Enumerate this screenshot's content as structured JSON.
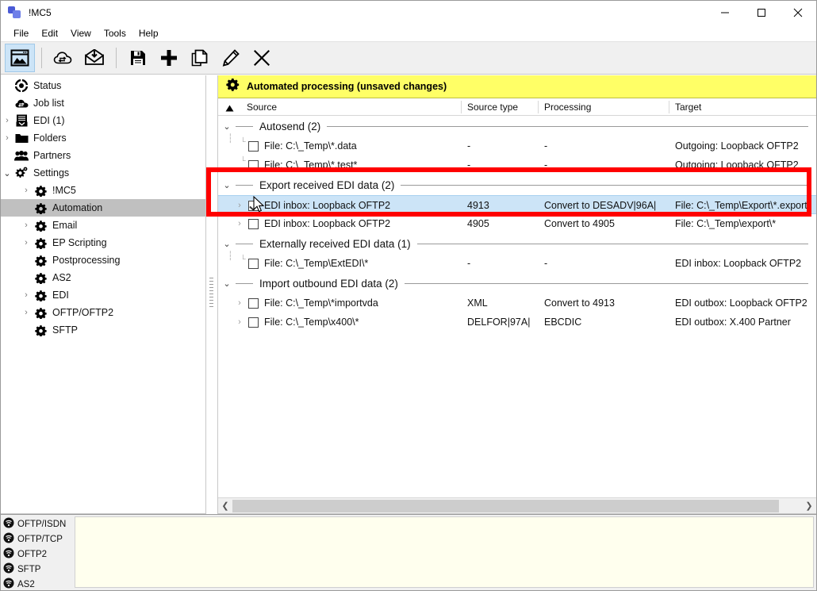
{
  "window": {
    "title": "!MC5",
    "app_icon": "app-logo-icon",
    "minimize": "minimize-icon",
    "maximize": "maximize-icon",
    "close": "close-icon"
  },
  "menu": {
    "items": [
      "File",
      "Edit",
      "View",
      "Tools",
      "Help"
    ]
  },
  "toolbar": {
    "buttons": [
      {
        "name": "overview-window-icon",
        "active": true
      },
      {
        "name": "cloud-transfer-icon",
        "active": false
      },
      {
        "name": "receive-mail-icon",
        "active": false
      },
      {
        "name": "save-icon",
        "active": false
      },
      {
        "name": "add-plus-icon",
        "active": false
      },
      {
        "name": "copy-page-icon",
        "active": false
      },
      {
        "name": "edit-pencil-icon",
        "active": false
      },
      {
        "name": "delete-x-icon",
        "active": false
      }
    ]
  },
  "sidebar": {
    "items": [
      {
        "label": "Status",
        "icon": "status-icon",
        "indent": 0,
        "chevron": "none",
        "selected": false
      },
      {
        "label": "Job list",
        "icon": "joblist-icon",
        "indent": 0,
        "chevron": "none",
        "selected": false
      },
      {
        "label": "EDI (1)",
        "icon": "edi-icon",
        "indent": 0,
        "chevron": "right",
        "selected": false
      },
      {
        "label": "Folders",
        "icon": "folder-icon",
        "indent": 0,
        "chevron": "right",
        "selected": false
      },
      {
        "label": "Partners",
        "icon": "partners-icon",
        "indent": 0,
        "chevron": "none",
        "selected": false
      },
      {
        "label": "Settings",
        "icon": "settings-gear-icon",
        "indent": 0,
        "chevron": "down",
        "selected": false
      },
      {
        "label": "!MC5",
        "icon": "gear-icon",
        "indent": 1,
        "chevron": "right",
        "selected": false
      },
      {
        "label": "Automation",
        "icon": "gear-icon",
        "indent": 1,
        "chevron": "none",
        "selected": true
      },
      {
        "label": "Email",
        "icon": "gear-icon",
        "indent": 1,
        "chevron": "right",
        "selected": false
      },
      {
        "label": "EP Scripting",
        "icon": "gear-icon",
        "indent": 1,
        "chevron": "right",
        "selected": false
      },
      {
        "label": "Postprocessing",
        "icon": "gear-icon",
        "indent": 1,
        "chevron": "none",
        "selected": false
      },
      {
        "label": "AS2",
        "icon": "gear-icon",
        "indent": 1,
        "chevron": "none",
        "selected": false
      },
      {
        "label": "EDI",
        "icon": "gear-icon",
        "indent": 1,
        "chevron": "right",
        "selected": false
      },
      {
        "label": "OFTP/OFTP2",
        "icon": "gear-icon",
        "indent": 1,
        "chevron": "right",
        "selected": false
      },
      {
        "label": "SFTP",
        "icon": "gear-icon",
        "indent": 1,
        "chevron": "none",
        "selected": false
      }
    ]
  },
  "main": {
    "header_title": "Automated processing (unsaved changes)",
    "header_icon": "gear-icon",
    "columns": [
      "Source",
      "Source type",
      "Processing",
      "Target"
    ],
    "sort_indicator": "sort-ascending-icon",
    "groups": [
      {
        "title": "Autosend (2)",
        "expanded": true,
        "rows": [
          {
            "source": "File: C:\\_Temp\\*.data",
            "source_type": "-",
            "processing": "-",
            "target": "Outgoing: Loopback OFTP2",
            "checked": false,
            "expandable": false,
            "selected": false
          },
          {
            "source": "File: C:\\_Temp\\*.test*",
            "source_type": "-",
            "processing": "-",
            "target": "Outgoing: Loopback OFTP2",
            "checked": false,
            "expandable": false,
            "selected": false
          }
        ]
      },
      {
        "title": "Export received EDI data (2)",
        "expanded": true,
        "rows": [
          {
            "source": "EDI inbox: Loopback OFTP2",
            "source_type": "4913",
            "processing": "Convert to DESADV|96A|",
            "target": "File: C:\\_Temp\\Export\\*.export",
            "checked": true,
            "expandable": true,
            "selected": true
          },
          {
            "source": "EDI inbox: Loopback OFTP2",
            "source_type": "4905",
            "processing": "Convert to 4905",
            "target": "File: C:\\_Temp\\export\\*",
            "checked": false,
            "expandable": true,
            "selected": false
          }
        ]
      },
      {
        "title": "Externally received EDI data (1)",
        "expanded": true,
        "rows": [
          {
            "source": "File: C:\\_Temp\\ExtEDI\\*",
            "source_type": "-",
            "processing": "-",
            "target": "EDI inbox: Loopback OFTP2",
            "checked": false,
            "expandable": false,
            "selected": false
          }
        ]
      },
      {
        "title": "Import outbound EDI data (2)",
        "expanded": true,
        "rows": [
          {
            "source": "File: C:\\_Temp\\*importvda",
            "source_type": "XML",
            "processing": "Convert to 4913",
            "target": "EDI outbox: Loopback OFTP2",
            "checked": false,
            "expandable": true,
            "selected": false
          },
          {
            "source": "File: C:\\_Temp\\x400\\*",
            "source_type": "DELFOR|97A|",
            "processing": "EBCDIC",
            "target": "EDI outbox: X.400 Partner",
            "checked": false,
            "expandable": true,
            "selected": false
          }
        ]
      }
    ],
    "hscroll": {
      "left_arrow": "scroll-left-icon",
      "right_arrow": "scroll-right-icon"
    }
  },
  "status": {
    "protocols": [
      {
        "label": "OFTP/ISDN",
        "icon": "connection-icon"
      },
      {
        "label": "OFTP/TCP",
        "icon": "connection-icon"
      },
      {
        "label": "OFTP2",
        "icon": "connection-icon"
      },
      {
        "label": "SFTP",
        "icon": "connection-icon"
      },
      {
        "label": "AS2",
        "icon": "connection-icon"
      }
    ],
    "log_text": ""
  },
  "annotation": {
    "type": "red-rectangle-highlight",
    "color": "#ff0000"
  },
  "colors": {
    "header_yellow": "#ffff66",
    "selection_blue": "#cce4f7",
    "sidebar_selection": "#c0c0c0",
    "toolbar_bg": "#f0f0f0",
    "log_bg": "#ffffee",
    "annotation_red": "#ff0000"
  }
}
